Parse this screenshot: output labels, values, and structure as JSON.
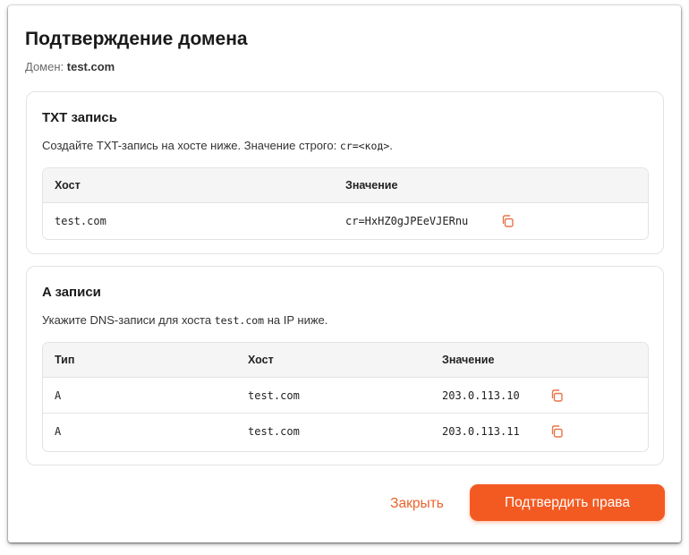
{
  "dialog": {
    "title": "Подтверждение домена",
    "domain_label": "Домен:",
    "domain_value": "test.com"
  },
  "txt_section": {
    "title": "TXT запись",
    "desc_text": "Создайте TXT-запись на хосте ниже. Значение строго:",
    "desc_code": "cr=<код>",
    "desc_end": ".",
    "headers": [
      "Хост",
      "Значение"
    ],
    "rows": [
      {
        "host": "test.com",
        "value": "cr=HxHZ0gJPEeVJERnu"
      }
    ]
  },
  "a_section": {
    "title": "A записи",
    "desc_before": "Укажите DNS-записи для хоста",
    "desc_code": "test.com",
    "desc_after": "на IP ниже.",
    "headers": [
      "Тип",
      "Хост",
      "Значение"
    ],
    "rows": [
      {
        "type": "A",
        "host": "test.com",
        "value": "203.0.113.10"
      },
      {
        "type": "A",
        "host": "test.com",
        "value": "203.0.113.11"
      }
    ]
  },
  "buttons": {
    "close": "Закрыть",
    "confirm": "Подтвердить права"
  },
  "colors": {
    "accent": "#f35a22",
    "link": "#e8632d",
    "icon": "#e8754a"
  },
  "icons": {
    "copy": "copy-icon"
  }
}
